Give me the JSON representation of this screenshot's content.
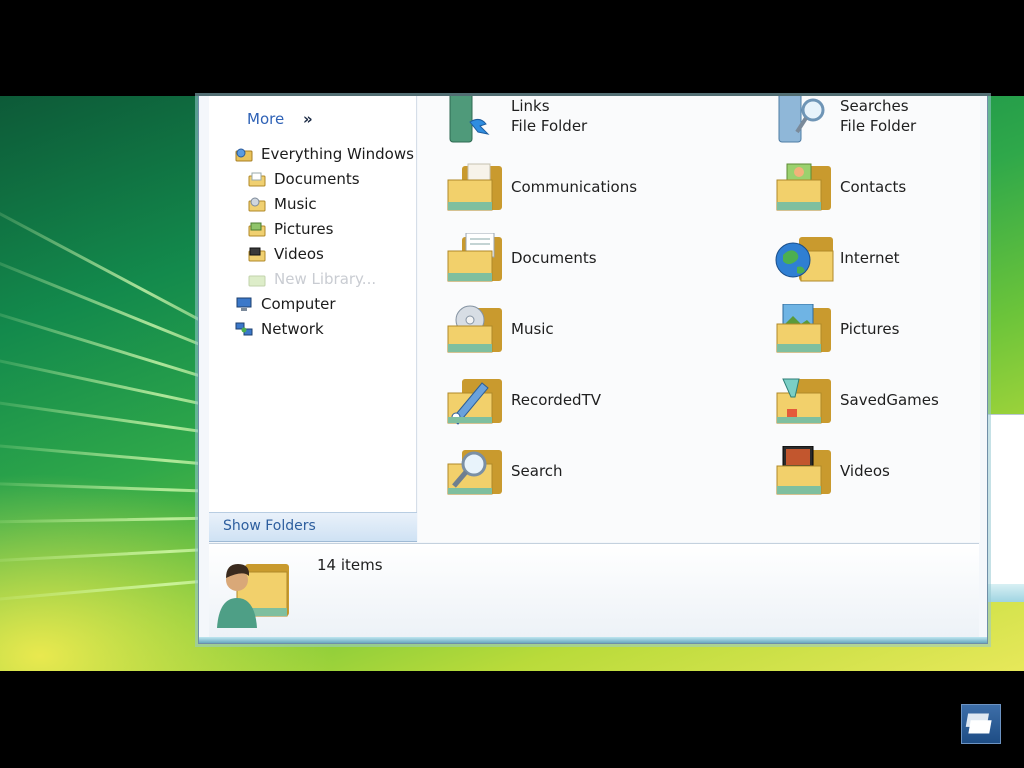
{
  "nav": {
    "more_label": "More",
    "more_chevron": "»",
    "items": [
      {
        "label": "Everything Windows",
        "icon": "library-icon",
        "level": 0,
        "disabled": false
      },
      {
        "label": "Documents",
        "icon": "documents-library-icon",
        "level": 1,
        "disabled": false
      },
      {
        "label": "Music",
        "icon": "music-library-icon",
        "level": 1,
        "disabled": false
      },
      {
        "label": "Pictures",
        "icon": "pictures-library-icon",
        "level": 1,
        "disabled": false
      },
      {
        "label": "Videos",
        "icon": "videos-library-icon",
        "level": 1,
        "disabled": false
      },
      {
        "label": "New Library...",
        "icon": "new-library-icon",
        "level": 1,
        "disabled": true
      },
      {
        "label": "Computer",
        "icon": "computer-icon",
        "level": 0,
        "disabled": false
      },
      {
        "label": "Network",
        "icon": "network-icon",
        "level": 0,
        "disabled": false
      }
    ],
    "show_folders_label": "Show Folders"
  },
  "content": {
    "items": [
      {
        "name": "Links",
        "type": "File Folder",
        "icon": "links-folder-icon"
      },
      {
        "name": "Searches",
        "type": "File Folder",
        "icon": "searches-folder-icon"
      },
      {
        "name": "Communications",
        "icon": "communications-folder-icon"
      },
      {
        "name": "Contacts",
        "icon": "contacts-folder-icon"
      },
      {
        "name": "Documents",
        "icon": "documents-folder-icon"
      },
      {
        "name": "Internet",
        "icon": "internet-folder-icon"
      },
      {
        "name": "Music",
        "icon": "music-folder-icon"
      },
      {
        "name": "Pictures",
        "icon": "pictures-folder-icon"
      },
      {
        "name": "RecordedTV",
        "icon": "recorded-tv-folder-icon"
      },
      {
        "name": "SavedGames",
        "icon": "saved-games-folder-icon"
      },
      {
        "name": "Search",
        "icon": "search-folder-icon"
      },
      {
        "name": "Videos",
        "icon": "videos-folder-icon"
      }
    ]
  },
  "details": {
    "count_label": "14 items",
    "icon": "user-folder-icon"
  },
  "colors": {
    "link_blue": "#2f62b6",
    "folder_yellow": "#f2d06b",
    "folder_dark": "#c99a2e"
  }
}
